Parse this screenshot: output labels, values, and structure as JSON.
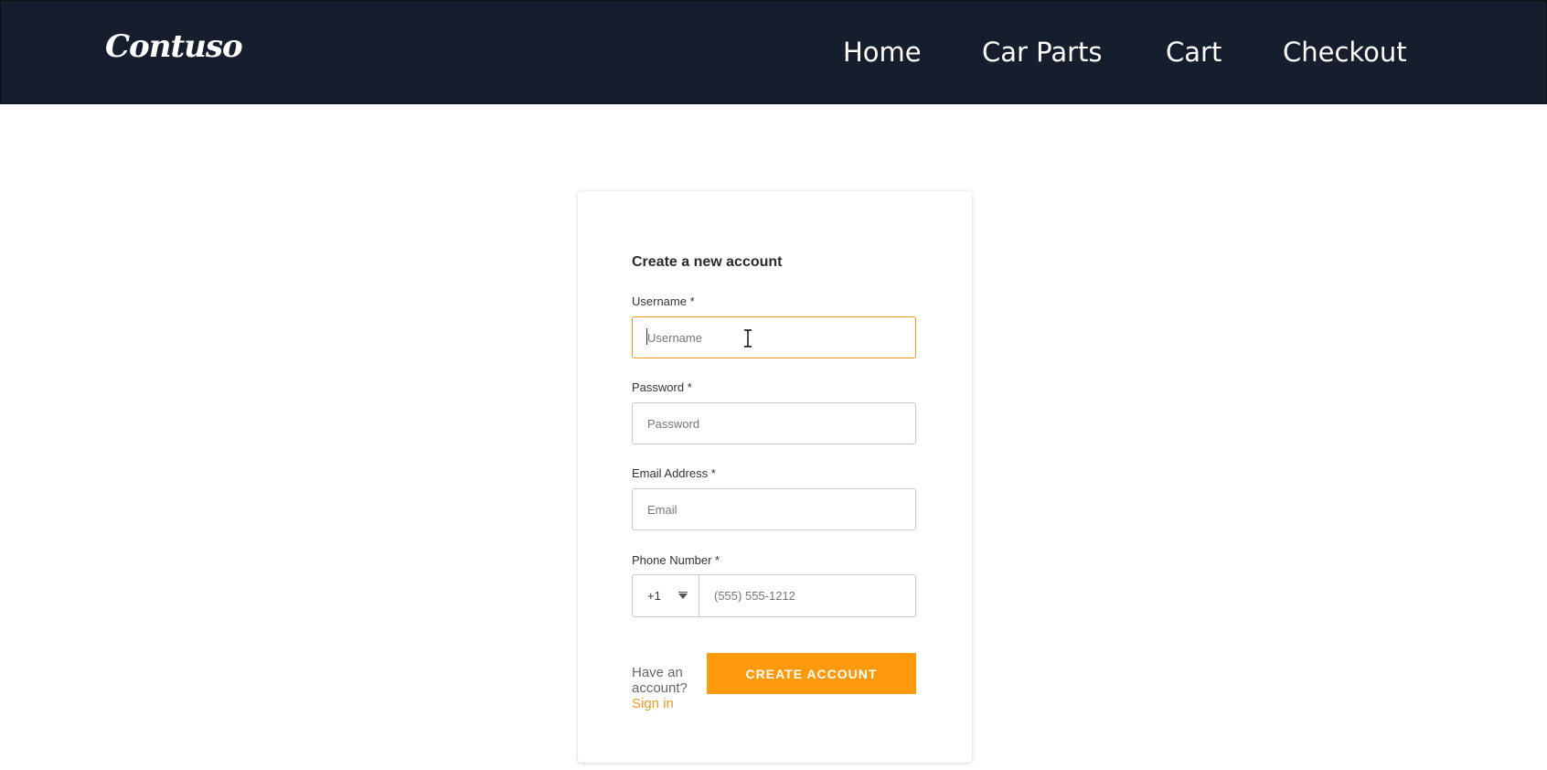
{
  "header": {
    "logo": "Contuso",
    "nav": [
      "Home",
      "Car Parts",
      "Cart",
      "Checkout"
    ]
  },
  "form": {
    "title": "Create a new account",
    "username": {
      "label": "Username *",
      "placeholder": "Username",
      "value": ""
    },
    "password": {
      "label": "Password *",
      "placeholder": "Password",
      "value": ""
    },
    "email": {
      "label": "Email Address *",
      "placeholder": "Email",
      "value": ""
    },
    "phone": {
      "label": "Phone Number *",
      "country_code": "+1",
      "placeholder": "(555) 555-1212",
      "value": ""
    },
    "have_account_text": "Have an account?",
    "sign_in_link": "Sign in",
    "submit_label": "CREATE ACCOUNT"
  },
  "colors": {
    "header_bg": "#161d2d",
    "accent": "#ff9a0d",
    "focus_border": "#f39a1e",
    "link": "#f39a1e"
  },
  "icons": {
    "country_dropdown": "chevron-down-icon",
    "text_cursor": "text-cursor-icon"
  }
}
